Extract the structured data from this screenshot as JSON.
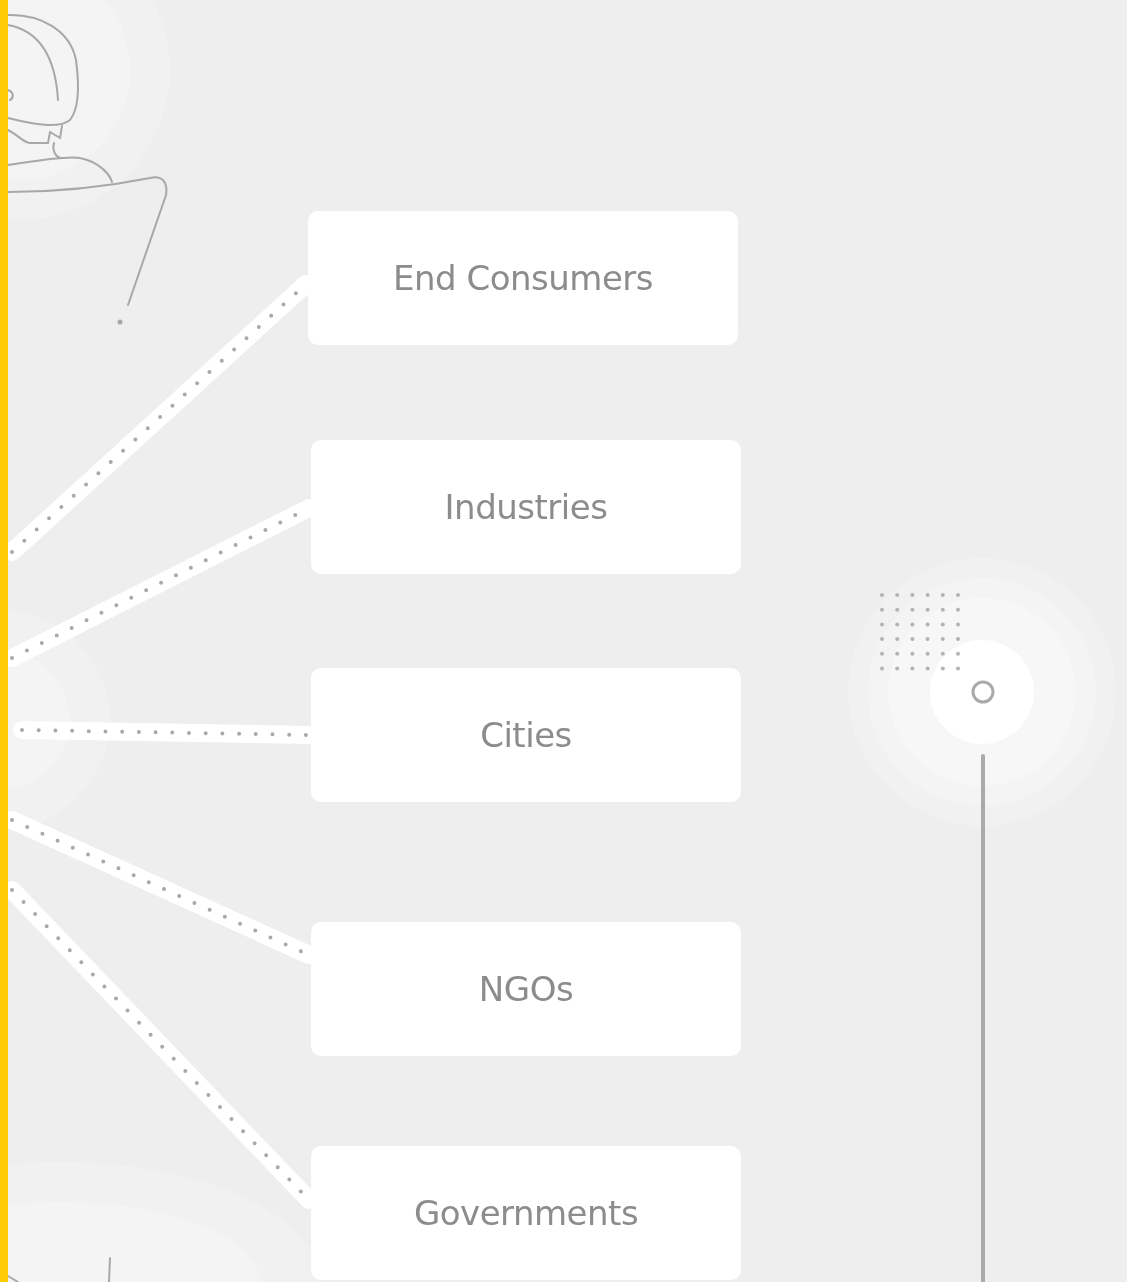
{
  "audiences": [
    {
      "label": "End Consumers"
    },
    {
      "label": "Industries"
    },
    {
      "label": "Cities"
    },
    {
      "label": "NGOs"
    },
    {
      "label": "Governments"
    }
  ]
}
